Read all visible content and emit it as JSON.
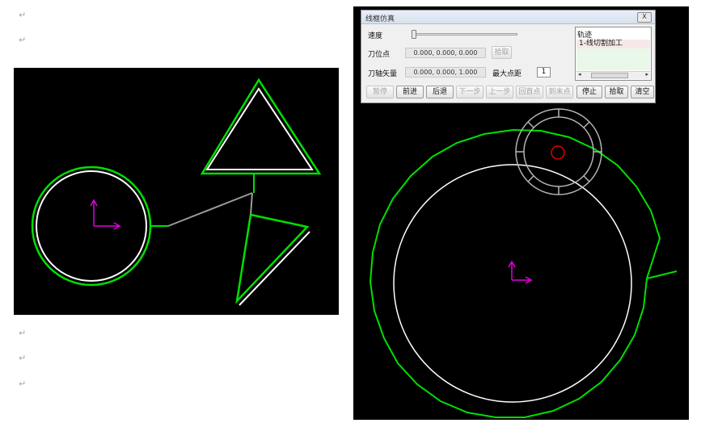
{
  "document": {
    "paragraph_mark": "↵"
  },
  "dialog": {
    "title": "线框仿真",
    "close_label": "X",
    "speed_label": "速度",
    "tool_point_label": "刀位点",
    "tool_point_value": "0.000, 0.000, 0.000",
    "pick_label": "拾取",
    "tool_axis_label": "刀轴矢量",
    "tool_axis_value": "0.000, 0.000, 1.000",
    "max_dist_label": "最大点距",
    "max_dist_value": "1",
    "speed_fraction": 0.02,
    "list": {
      "header": "轨迹",
      "items": [
        "1-线切割加工"
      ]
    },
    "buttons": {
      "pause": "暂停",
      "forward": "前进",
      "back": "后退",
      "next_step": "下一步",
      "prev_step": "上一步",
      "to_first": "回首点",
      "to_last": "到末点",
      "stop": "停止",
      "pick": "拾取",
      "clear": "清空"
    }
  },
  "colors": {
    "canvas_bg": "#000000",
    "path_green": "#00e000",
    "contour_white": "#ffffff",
    "axis_magenta": "#e100e1",
    "tool_red": "#e00000",
    "connector_gray": "#9a9a9a"
  }
}
